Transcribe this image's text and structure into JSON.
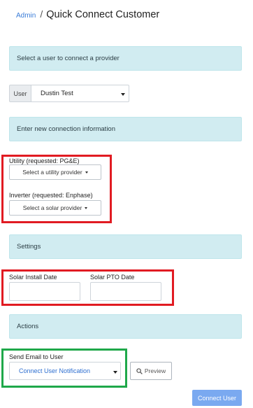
{
  "breadcrumb": {
    "parent": "Admin",
    "separator": "/",
    "title": "Quick Connect Customer"
  },
  "sections": {
    "select_user": "Select a user to connect a provider",
    "new_connection": "Enter new connection information",
    "settings": "Settings",
    "actions": "Actions"
  },
  "user": {
    "label": "User",
    "selected": "Dustin Test"
  },
  "utility": {
    "label": "Utility (requested: PG&E)",
    "button": "Select a utility provider"
  },
  "inverter": {
    "label": "Inverter (requested: Enphase)",
    "button": "Select a solar provider"
  },
  "dates": {
    "install_label": "Solar Install Date",
    "install_value": "",
    "pto_label": "Solar PTO Date",
    "pto_value": ""
  },
  "email": {
    "label": "Send Email to User",
    "selected": "Connect User Notification",
    "preview_label": "Preview"
  },
  "submit": {
    "label": "Connect User"
  },
  "colors": {
    "banner_bg": "#d1ecf1",
    "highlight_red": "#e11b22",
    "highlight_green": "#1fa84a",
    "primary_button": "#7aa9f0",
    "link": "#3b7dd8"
  },
  "icons": {
    "preview": "search-icon",
    "dropdown": "caret-down-icon"
  }
}
